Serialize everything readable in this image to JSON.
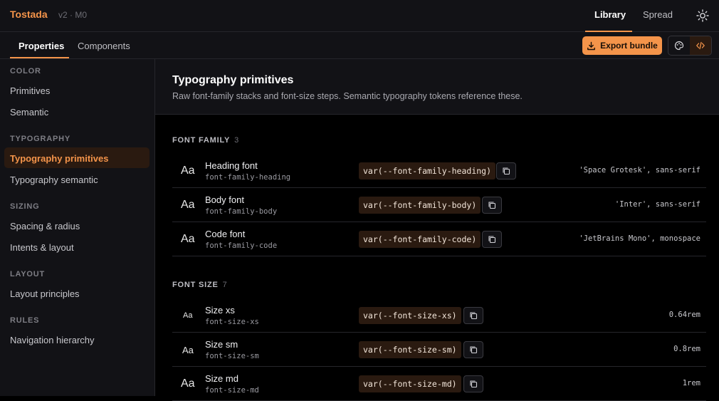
{
  "app": {
    "title": "Tostada",
    "version": "v2 · M0"
  },
  "top_tabs": [
    {
      "label": "Library",
      "active": true
    },
    {
      "label": "Spread",
      "active": false
    }
  ],
  "sub_tabs": [
    {
      "label": "Properties",
      "active": true
    },
    {
      "label": "Components",
      "active": false
    }
  ],
  "toolbar": {
    "export_label": "Export bundle"
  },
  "sidebar": {
    "sections": [
      {
        "label": "COLOR",
        "items": [
          "Primitives",
          "Semantic"
        ]
      },
      {
        "label": "TYPOGRAPHY",
        "items": [
          "Typography primitives",
          "Typography semantic"
        ]
      },
      {
        "label": "SIZING",
        "items": [
          "Spacing & radius",
          "Intents & layout"
        ]
      },
      {
        "label": "LAYOUT",
        "items": [
          "Layout principles"
        ]
      },
      {
        "label": "RULES",
        "items": [
          "Navigation hierarchy"
        ]
      }
    ],
    "active_item": "Typography primitives"
  },
  "main": {
    "title": "Typography primitives",
    "subtitle": "Raw font-family stacks and font-size steps. Semantic typography tokens reference these."
  },
  "font_family": {
    "label": "FONT FAMILY",
    "count": "3",
    "rows": [
      {
        "sample": "Aa",
        "name": "Heading font",
        "token": "font-family-heading",
        "var": "var(--font-family-heading)",
        "value": "'Space Grotesk', sans-serif"
      },
      {
        "sample": "Aa",
        "name": "Body font",
        "token": "font-family-body",
        "var": "var(--font-family-body)",
        "value": "'Inter', sans-serif"
      },
      {
        "sample": "Aa",
        "name": "Code font",
        "token": "font-family-code",
        "var": "var(--font-family-code)",
        "value": "'JetBrains Mono', monospace"
      }
    ]
  },
  "font_size": {
    "label": "FONT SIZE",
    "count": "7",
    "rows": [
      {
        "sample": "Aa",
        "name": "Size xs",
        "token": "font-size-xs",
        "var": "var(--font-size-xs)",
        "value": "0.64rem"
      },
      {
        "sample": "Aa",
        "name": "Size sm",
        "token": "font-size-sm",
        "var": "var(--font-size-sm)",
        "value": "0.8rem"
      },
      {
        "sample": "Aa",
        "name": "Size md",
        "token": "font-size-md",
        "var": "var(--font-size-md)",
        "value": "1rem"
      }
    ]
  },
  "colors": {
    "accent": "#f4944a",
    "background": "#000000",
    "panel": "#121216"
  }
}
